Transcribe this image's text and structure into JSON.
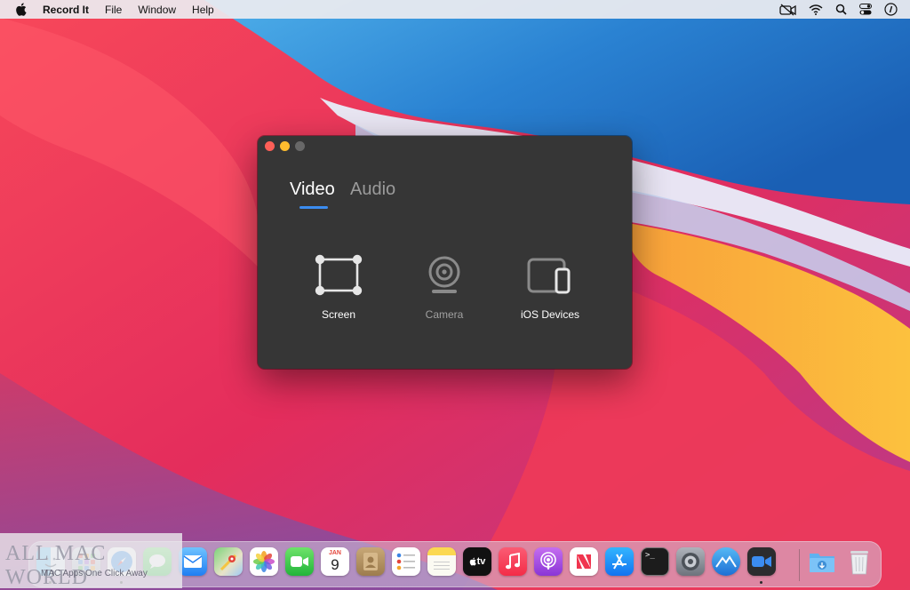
{
  "menubar": {
    "apple_icon": "apple-icon",
    "app_name": "Record It",
    "items": [
      "File",
      "Window",
      "Help"
    ],
    "status_icons": [
      "video-slash-icon",
      "wifi-icon",
      "search-icon",
      "control-center-icon",
      "siri-info-icon"
    ]
  },
  "window": {
    "tabs": [
      {
        "label": "Video",
        "active": true
      },
      {
        "label": "Audio",
        "active": false
      }
    ],
    "sources": [
      {
        "label": "Screen",
        "icon": "screen-selection-icon",
        "enabled": true
      },
      {
        "label": "Camera",
        "icon": "webcam-icon",
        "enabled": false
      },
      {
        "label": "iOS Devices",
        "icon": "ios-device-icon",
        "enabled": true
      }
    ],
    "accent_color": "#3b8cf0",
    "background_color": "#363636"
  },
  "dock": {
    "apps": [
      {
        "name": "finder",
        "icon": "finder-icon"
      },
      {
        "name": "launchpad",
        "icon": "launchpad-icon"
      },
      {
        "name": "safari",
        "icon": "safari-icon"
      },
      {
        "name": "messages",
        "icon": "messages-icon"
      },
      {
        "name": "mail",
        "icon": "mail-icon"
      },
      {
        "name": "maps",
        "icon": "maps-icon"
      },
      {
        "name": "photos",
        "icon": "photos-icon"
      },
      {
        "name": "facetime",
        "icon": "facetime-icon"
      },
      {
        "name": "calendar",
        "icon": "calendar-icon",
        "month": "JAN",
        "day": "9"
      },
      {
        "name": "contacts",
        "icon": "contacts-icon"
      },
      {
        "name": "reminders",
        "icon": "reminders-icon"
      },
      {
        "name": "notes",
        "icon": "notes-icon"
      },
      {
        "name": "tv",
        "icon": "apple-tv-icon",
        "label": "tv"
      },
      {
        "name": "music",
        "icon": "music-icon"
      },
      {
        "name": "podcasts",
        "icon": "podcasts-icon"
      },
      {
        "name": "news",
        "icon": "news-icon"
      },
      {
        "name": "app-store",
        "icon": "app-store-icon"
      },
      {
        "name": "terminal",
        "icon": "terminal-icon",
        "label": ">_"
      },
      {
        "name": "system-preferences",
        "icon": "system-preferences-icon"
      },
      {
        "name": "altitude",
        "icon": "mountain-app-icon"
      },
      {
        "name": "record-it",
        "icon": "record-it-icon"
      },
      {
        "name": "downloads",
        "icon": "downloads-folder-icon"
      },
      {
        "name": "trash",
        "icon": "trash-icon"
      }
    ]
  },
  "watermark": {
    "main": "ALL MAC WORLD",
    "sub": "MAC Apps One Click Away"
  }
}
